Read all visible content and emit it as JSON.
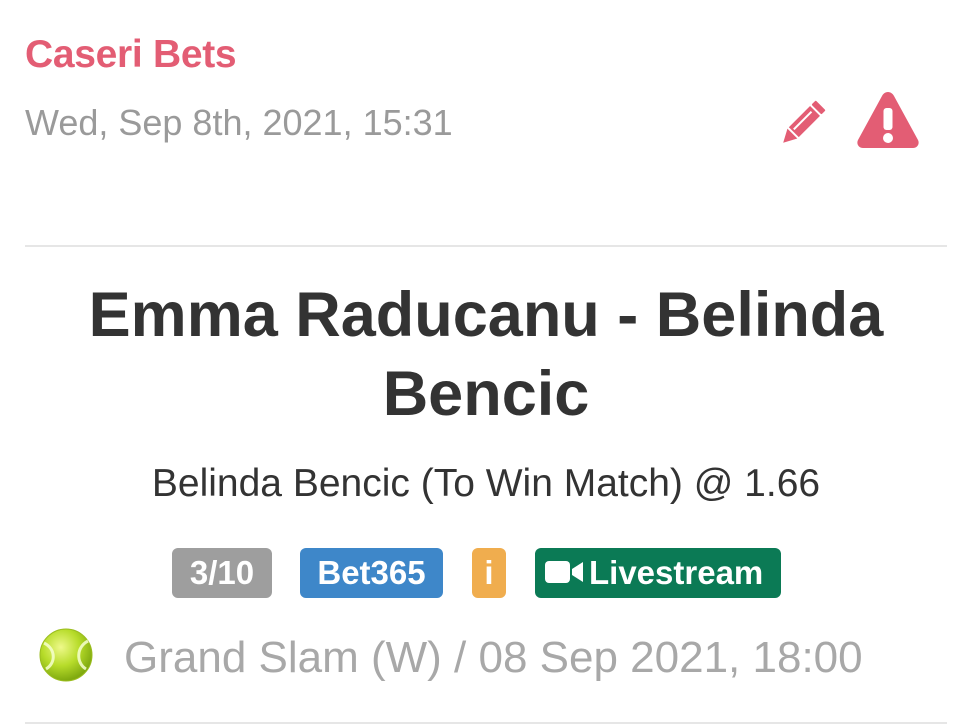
{
  "header": {
    "tipster_name": "Caseri Bets",
    "posted_at": "Wed, Sep 8th, 2021, 15:31"
  },
  "actions": {
    "edit_icon": "pencil-icon",
    "report_icon": "warning-icon"
  },
  "match": {
    "title": "Emma Raducanu - Belinda Bencic",
    "selection": "Belinda Bencic (To Win Match) @ 1.66"
  },
  "badges": {
    "stake": "3/10",
    "bookmaker": "Bet365",
    "info": "i",
    "livestream": "Livestream"
  },
  "event": {
    "sport_icon": "tennis-ball-icon",
    "details": "Grand Slam (W) / 08 Sep 2021, 18:00"
  },
  "colors": {
    "accent": "#e35d74",
    "stake_badge": "#9e9e9e",
    "bookmaker_badge": "#3e87c9",
    "info_badge": "#f0ad4e",
    "livestream_badge": "#0b7a55"
  }
}
